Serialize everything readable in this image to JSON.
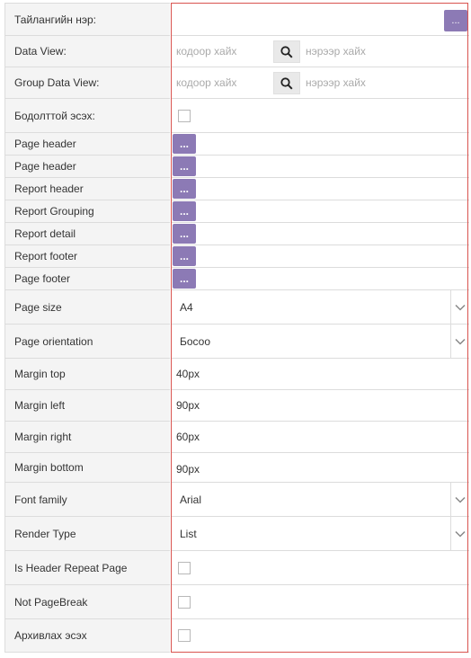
{
  "fields": {
    "template_name": {
      "label": "Тайлангийн нэр:",
      "button": "..."
    },
    "data_view": {
      "label": "Data View:",
      "code_placeholder": "кодоор хайх",
      "name_placeholder": "нэрээр хайх"
    },
    "group_data_view": {
      "label": "Group Data View:",
      "code_placeholder": "кодоор хайх",
      "name_placeholder": "нэрээр хайх"
    },
    "is_draft": {
      "label": "Бодолттой эсэх:"
    },
    "bands": [
      {
        "label": "Page header",
        "button": "..."
      },
      {
        "label": "Page header",
        "button": "..."
      },
      {
        "label": "Report header",
        "button": "..."
      },
      {
        "label": "Report Grouping",
        "button": "..."
      },
      {
        "label": "Report detail",
        "button": "..."
      },
      {
        "label": "Report footer",
        "button": "..."
      },
      {
        "label": "Page footer",
        "button": "..."
      }
    ],
    "page_size": {
      "label": "Page size",
      "value": "A4"
    },
    "page_orientation": {
      "label": "Page orientation",
      "value": "Босоо"
    },
    "margin_top": {
      "label": "Margin top",
      "value": "40px"
    },
    "margin_left": {
      "label": "Margin left",
      "value": "90px"
    },
    "margin_right": {
      "label": "Margin right",
      "value": "60px"
    },
    "margin_bottom": {
      "label": "Margin bottom",
      "value": "90px"
    },
    "font_family": {
      "label": "Font family",
      "value": "Arial"
    },
    "render_type": {
      "label": "Render Type",
      "value": "List"
    },
    "header_repeat": {
      "label": "Is Header Repeat Page"
    },
    "not_page_break": {
      "label": "Not PageBreak"
    },
    "archive": {
      "label": "Архивлах эсэх"
    }
  },
  "icons": {
    "search": "search-icon",
    "dropdown": "chevron-down-icon"
  },
  "colors": {
    "accent_button": "#8c7ab5",
    "frame_border": "#d9534f",
    "label_bg": "#f4f4f4"
  }
}
